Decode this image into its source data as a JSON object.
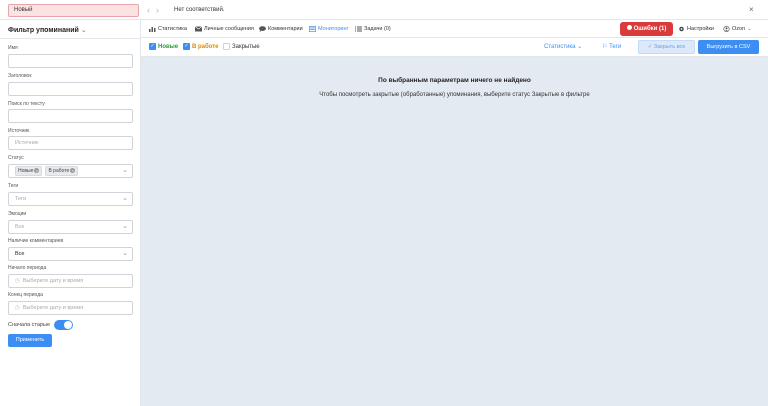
{
  "topbar": {
    "new_label": "Новый",
    "no_match_text": "Нет соответствий.",
    "close_glyph": "×"
  },
  "sidebar": {
    "title": "Фильтр упоминаний",
    "fields": {
      "name_label": "Имя",
      "title_label": "Заголовок",
      "text_search_label": "Поиск по тексту",
      "source_label": "Источник",
      "source_placeholder": "Источник",
      "status_label": "Статус",
      "status_tags": [
        "Новые",
        "В работе"
      ],
      "tags_label": "Теги",
      "tags_placeholder": "Теги",
      "emotions_label": "Эмоции",
      "emotions_value": "Все",
      "comments_label": "Наличие комментариев",
      "comments_value": "Все",
      "period_start_label": "Начало периода",
      "period_start_placeholder": "Выберите дату и время",
      "period_end_label": "Конец периода",
      "period_end_placeholder": "Выберите дату и время"
    },
    "oldest_first_label": "Сначала старые",
    "oldest_first_on": true,
    "apply_label": "Применить"
  },
  "nav": {
    "items": [
      {
        "label": "Статистика",
        "icon": "chart-icon"
      },
      {
        "label": "Личные сообщения",
        "icon": "envelope-icon"
      },
      {
        "label": "Комментарии",
        "icon": "comment-icon"
      },
      {
        "label": "Мониторинг",
        "icon": "monitor-icon",
        "active": true
      },
      {
        "label": "Задачи (0)",
        "icon": "list-icon"
      }
    ],
    "errors_label": "Ошибки (1)",
    "settings_label": "Настройки",
    "user_label": "Ozon"
  },
  "filters": {
    "new_label": "Новые",
    "work_label": "В работе",
    "closed_label": "Закрытые",
    "new_checked": true,
    "work_checked": true,
    "closed_checked": false,
    "statistics_label": "Статистика",
    "tags_label": "Теги",
    "close_all_label": "Закрыть все",
    "export_csv_label": "Выгрузить в CSV"
  },
  "empty_state": {
    "title": "По выбранным параметрам ничего не найдено",
    "description": "Чтобы посмотреть закрытые (обработанные) упоминания, выберите статус Закрытые в фильтре"
  },
  "colors": {
    "accent": "#3d8ef2",
    "error": "#d93a3a",
    "new_status": "#2c9a3c",
    "work_status": "#e08a00",
    "main_bg": "#e4eaf1"
  }
}
